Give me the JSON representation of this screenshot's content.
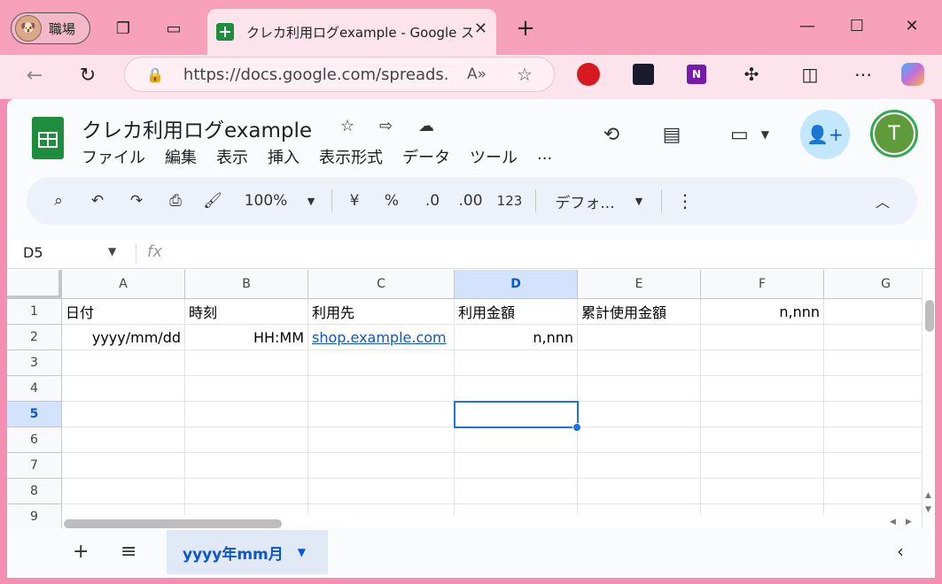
{
  "browser": {
    "profile_name": "職場",
    "tab_title": "クレカ利用ログexample - Google スプ",
    "url": "https://docs.google.com/spreads...",
    "new_tab": "+"
  },
  "doc": {
    "title": "クレカ利用ログexample",
    "menu": [
      "ファイル",
      "編集",
      "表示",
      "挿入",
      "表示形式",
      "データ",
      "ツール",
      "..."
    ],
    "user_initial": "T"
  },
  "toolbar": {
    "zoom": "100%",
    "currency": "¥",
    "percent": "%",
    "dec_decrease": ".0",
    "dec_increase": ".00",
    "number_format": "123",
    "font": "デフォ..."
  },
  "formula_bar": {
    "cell_ref": "D5",
    "fx": "fx"
  },
  "sheet": {
    "columns": [
      "A",
      "B",
      "C",
      "D",
      "E",
      "F",
      "G"
    ],
    "rows": [
      "1",
      "2",
      "3",
      "4",
      "5",
      "6",
      "7",
      "8",
      "9"
    ],
    "selected_col": "D",
    "selected_row": "5",
    "cells": {
      "A1": "日付",
      "B1": "時刻",
      "C1": "利用先",
      "D1": "利用金額",
      "E1": "累計使用金額",
      "F1": "n,nnn",
      "A2": "yyyy/mm/dd",
      "B2": "HH:MM",
      "C2": "shop.example.com",
      "D2": "n,nnn"
    }
  },
  "sheet_tabs": {
    "active": "yyyy年mm月"
  }
}
